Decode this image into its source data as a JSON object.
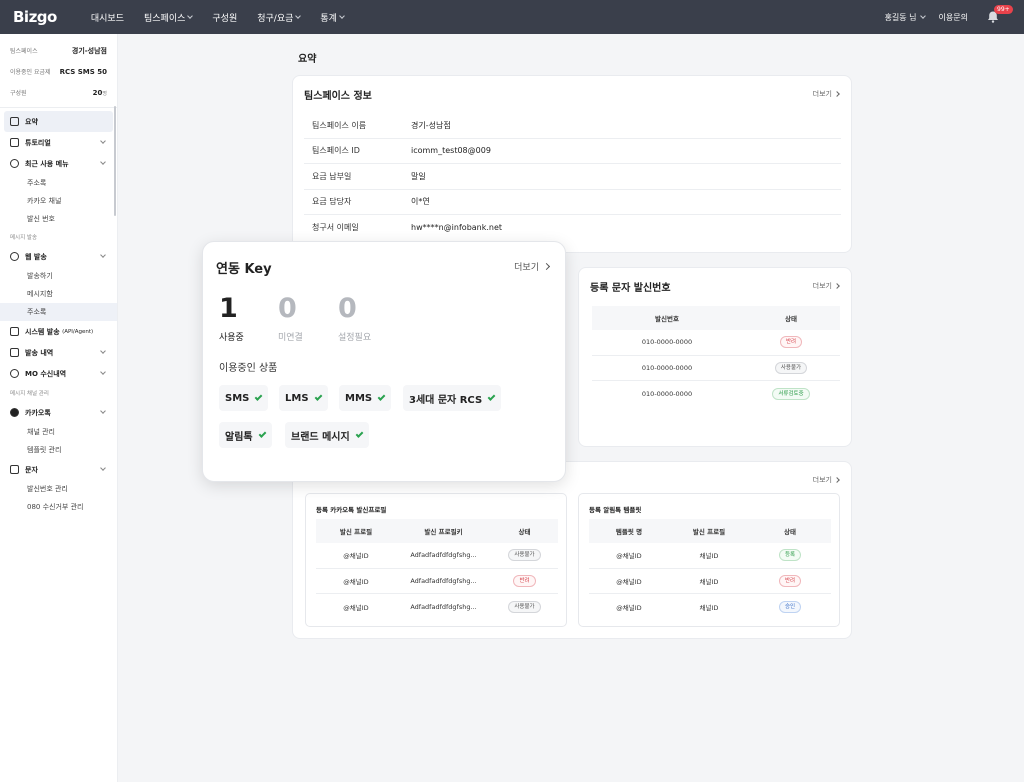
{
  "nav": {
    "logo": "Bizgo",
    "items": [
      {
        "label": "대시보드",
        "has_dropdown": false
      },
      {
        "label": "팀스페이스",
        "has_dropdown": true
      },
      {
        "label": "구성원",
        "has_dropdown": false
      },
      {
        "label": "청구/요금",
        "has_dropdown": true
      },
      {
        "label": "통계",
        "has_dropdown": true
      }
    ],
    "user": "홍길동 님",
    "help": "이용문의",
    "notification_badge": "99+"
  },
  "sidebar": {
    "teamspace_label": "팀스페이스",
    "teamspace_value": "경기-성남점",
    "plan_label": "이용중인 요금제",
    "plan_value": "RCS SMS 50",
    "members_label": "구성원",
    "members_value": "20",
    "members_unit": "명",
    "menu": {
      "summary": "요약",
      "tutorial": "튜토리얼",
      "recent": "최근 사용 메뉴",
      "recent_sub": [
        "주소록",
        "카카오 채널",
        "발신 번호"
      ],
      "section_message": "메시지 발송",
      "web_send": "웹 발송",
      "web_sub": [
        "발송하기",
        "메시지함",
        "주소록"
      ],
      "system_send": "시스템 발송",
      "system_send_suffix": "(API/Agent)",
      "send_history": "발송 내역",
      "mo_history": "MO 수신내역",
      "section_channel": "메시지 채널 관리",
      "kakaotalk": "카카오톡",
      "kakao_sub": [
        "채널 관리",
        "템플릿 관리"
      ],
      "sms": "문자",
      "sms_sub": [
        "발신번호 관리",
        "080 수신거부 관리"
      ]
    }
  },
  "page_title": "요약",
  "more_label": "더보기",
  "teamspace_card": {
    "title": "팀스페이스 정보",
    "rows": [
      {
        "key": "팀스페이스 이름",
        "value": "경기-성남점"
      },
      {
        "key": "팀스페이스 ID",
        "value": "icomm_test08@009"
      },
      {
        "key": "요금 납부일",
        "value": "말일"
      },
      {
        "key": "요금 담당자",
        "value": "이*연"
      },
      {
        "key": "청구서 이메일",
        "value": "hw****n@infobank.net"
      }
    ]
  },
  "sender_card": {
    "title": "등록 문자 발신번호",
    "headers": [
      "발신번호",
      "상태"
    ],
    "rows": [
      {
        "number": "010-0000-0000",
        "status": "반려",
        "color": "red"
      },
      {
        "number": "010-0000-0000",
        "status": "사용불가",
        "color": "gray"
      },
      {
        "number": "010-0000-0000",
        "status": "서류검토중",
        "color": "green"
      }
    ]
  },
  "kakao_card": {
    "profile_title": "등록 카카오톡 발신프로필",
    "profile_headers": [
      "발신 프로필",
      "발신 프로필키",
      "상태"
    ],
    "profile_rows": [
      {
        "profile": "@채널ID",
        "key": "Adfadfadfdfdgfshg...",
        "status": "사용불가",
        "color": "gray"
      },
      {
        "profile": "@채널ID",
        "key": "Adfadfadfdfdgfshg...",
        "status": "반려",
        "color": "red"
      },
      {
        "profile": "@채널ID",
        "key": "Adfadfadfdfdgfshg...",
        "status": "사용불가",
        "color": "gray"
      }
    ],
    "template_title": "등록 알림톡 템플릿",
    "template_headers": [
      "템플릿 명",
      "발신 프로필",
      "상태"
    ],
    "template_rows": [
      {
        "name": "@채널ID",
        "profile": "채널ID",
        "status": "등록",
        "color": "green"
      },
      {
        "name": "@채널ID",
        "profile": "채널ID",
        "status": "반려",
        "color": "red"
      },
      {
        "name": "@채널ID",
        "profile": "채널ID",
        "status": "승인",
        "color": "blue"
      }
    ]
  },
  "popup": {
    "title": "연동 Key",
    "more": "더보기",
    "stats": [
      {
        "value": "1",
        "label": "사용중"
      },
      {
        "value": "0",
        "label": "미연결"
      },
      {
        "value": "0",
        "label": "설정필요"
      }
    ],
    "products_label": "이용중인 상품",
    "products": [
      "SMS",
      "LMS",
      "MMS",
      "3세대 문자 RCS",
      "알림톡",
      "브랜드 메시지"
    ]
  },
  "colors": {
    "nav_bg": "#3a3f4b",
    "check_green": "#2aa24f",
    "badge_red": "#e8424b"
  }
}
